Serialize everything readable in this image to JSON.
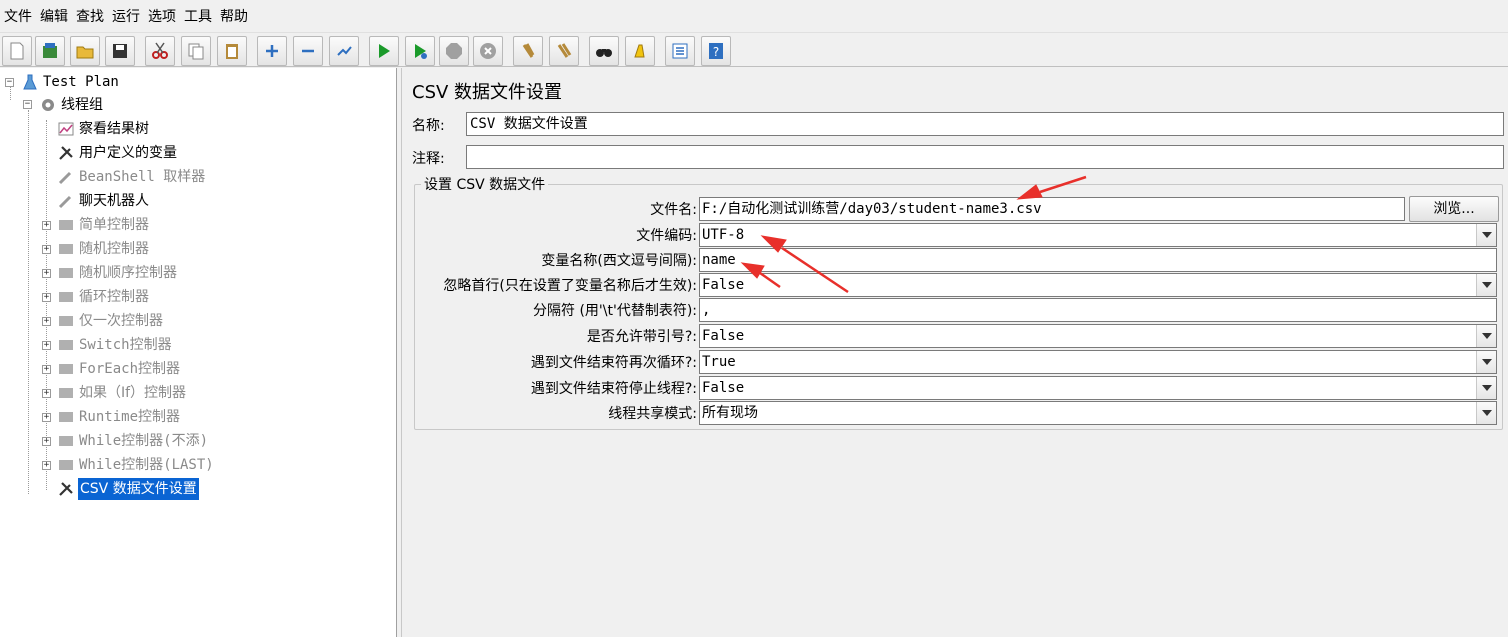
{
  "menu": [
    "文件",
    "编辑",
    "查找",
    "运行",
    "选项",
    "工具",
    "帮助"
  ],
  "toolbar_icons": [
    "new-icon",
    "templates-icon",
    "open-icon",
    "save-icon",
    "cut-icon",
    "copy-icon",
    "paste-icon",
    "expand-icon",
    "collapse-icon",
    "toggle-icon",
    "start-icon",
    "start-no-pause-icon",
    "stop-icon",
    "shutdown-icon",
    "clear-icon",
    "clear-all-icon",
    "search-icon",
    "reset-search-icon",
    "function-helper-icon",
    "help-icon"
  ],
  "tree": {
    "root": "Test Plan",
    "thread_group": "线程组",
    "items": [
      {
        "label": "察看结果树"
      },
      {
        "label": "用户定义的变量"
      },
      {
        "label": "BeanShell 取样器"
      },
      {
        "label": "聊天机器人"
      },
      {
        "label": "简单控制器"
      },
      {
        "label": "随机控制器"
      },
      {
        "label": "随机顺序控制器"
      },
      {
        "label": "循环控制器"
      },
      {
        "label": "仅一次控制器"
      },
      {
        "label": "Switch控制器"
      },
      {
        "label": "ForEach控制器"
      },
      {
        "label": "如果（If）控制器"
      },
      {
        "label": "Runtime控制器"
      },
      {
        "label": "While控制器(不添)"
      },
      {
        "label": "While控制器(LAST)"
      },
      {
        "label": "CSV 数据文件设置"
      }
    ]
  },
  "panel": {
    "title": "CSV 数据文件设置",
    "name_label": "名称:",
    "name_value": "CSV 数据文件设置",
    "comment_label": "注释:",
    "comment_value": "",
    "group_title": "设置 CSV 数据文件",
    "browse_label": "浏览...",
    "fields": [
      {
        "label": "文件名:",
        "value": "F:/自动化测试训练营/day03/student-name3.csv"
      },
      {
        "label": "文件编码:",
        "value": "UTF-8"
      },
      {
        "label": "变量名称(西文逗号间隔):",
        "value": "name"
      },
      {
        "label": "忽略首行(只在设置了变量名称后才生效):",
        "value": "False"
      },
      {
        "label": "分隔符 (用'\\t'代替制表符):",
        "value": ","
      },
      {
        "label": "是否允许带引号?:",
        "value": "False"
      },
      {
        "label": "遇到文件结束符再次循环?:",
        "value": "True"
      },
      {
        "label": "遇到文件结束符停止线程?:",
        "value": "False"
      },
      {
        "label": "线程共享模式:",
        "value": "所有现场"
      }
    ]
  },
  "colors": {
    "selection": "#0a64d3",
    "annotation_arrow": "#e8302b",
    "run_green": "#1a9a2a"
  }
}
